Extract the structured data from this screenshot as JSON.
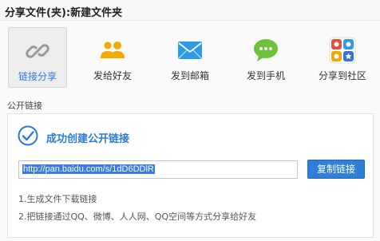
{
  "window": {
    "title": "分享文件(夹):新建文件夹"
  },
  "tabs": [
    {
      "label": "链接分享",
      "icon": "link-icon",
      "active": true
    },
    {
      "label": "发给好友",
      "icon": "friends-icon",
      "active": false
    },
    {
      "label": "发到邮箱",
      "icon": "mail-icon",
      "active": false
    },
    {
      "label": "发到手机",
      "icon": "chat-bubble-icon",
      "active": false
    },
    {
      "label": "分享到社区",
      "icon": "community-grid-icon",
      "active": false
    }
  ],
  "section": {
    "label": "公开链接"
  },
  "result": {
    "success_text": "成功创建公开链接",
    "link_value": "http://pan.baidu.com/s/1dD6DDlR",
    "copy_label": "复制链接"
  },
  "tips": [
    "1.生成文件下载链接",
    "2.把链接通过QQ、微博、人人网、QQ空间等方式分享给好友"
  ],
  "colors": {
    "accent": "#2b7bd6",
    "button": "#2f7fd8",
    "friends": "#f2a900",
    "mail": "#2e9be6",
    "chat": "#6cc23a"
  }
}
